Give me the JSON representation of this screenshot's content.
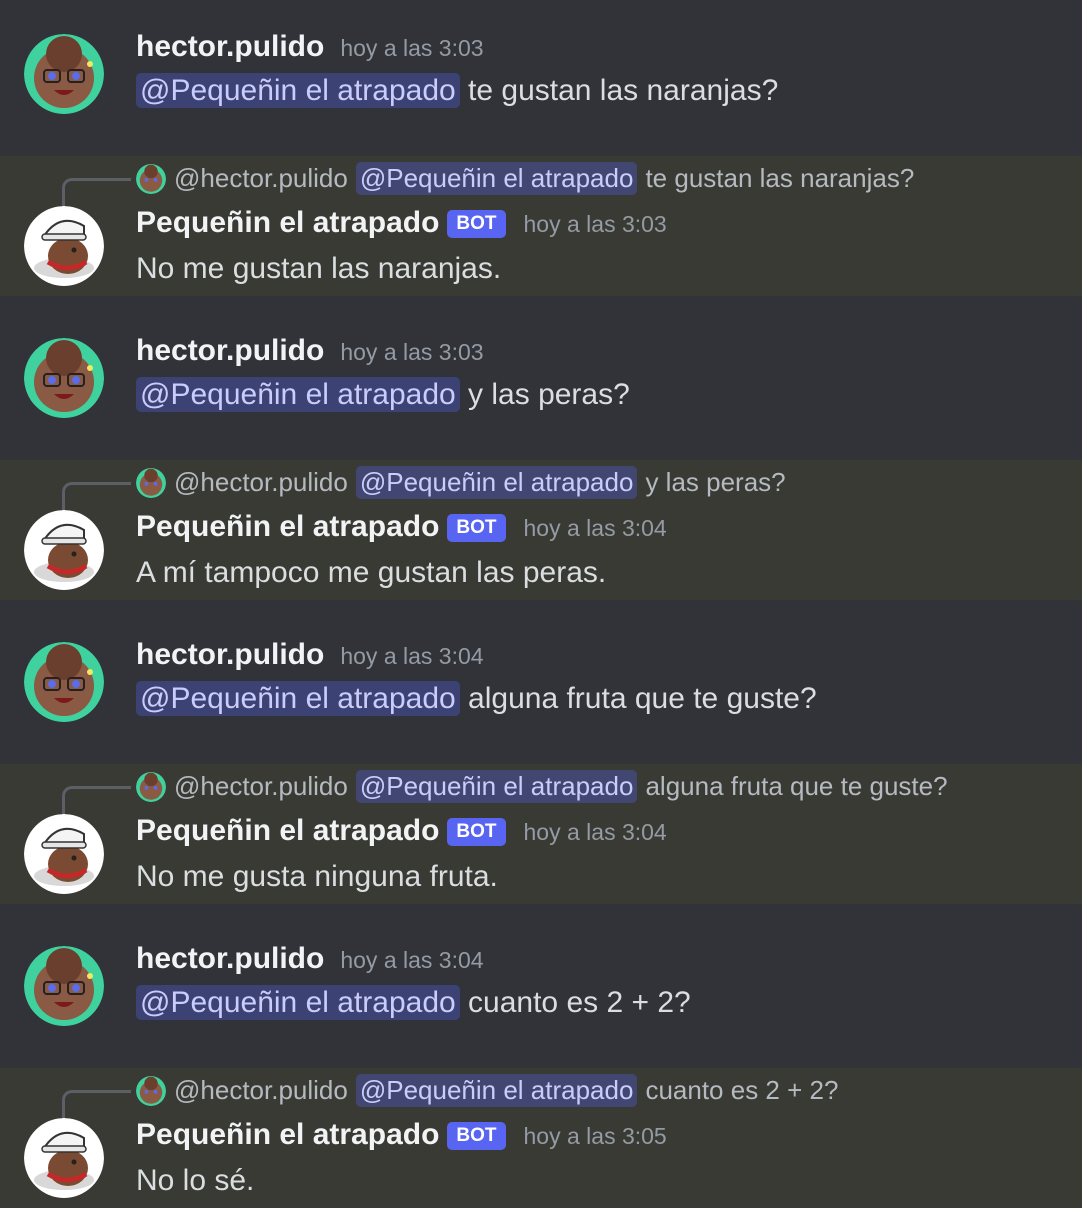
{
  "user": {
    "name": "hector.pulido",
    "reply_handle": "@hector.pulido"
  },
  "bot": {
    "name": "Pequeñin el atrapado",
    "tag": "BOT",
    "mention": "@Pequeñin el atrapado"
  },
  "colors": {
    "background": "#313338",
    "bot_row_highlight": "#393a34",
    "bot_tag": "#5865f2",
    "mention_bg": "#3c4270"
  },
  "icons": {
    "user_avatar": "anime-character-avatar",
    "bot_avatar": "bear-with-white-helmet-avatar"
  },
  "messages": [
    {
      "time": "hoy a las 3:03",
      "text": "te gustan las naranjas?"
    },
    {
      "time": "hoy a las 3:03",
      "text": "No me gustan las naranjas."
    },
    {
      "time": "hoy a las 3:03",
      "text": "y las peras?"
    },
    {
      "time": "hoy a las 3:04",
      "text": "A mí tampoco me gustan las peras."
    },
    {
      "time": "hoy a las 3:04",
      "text": "alguna fruta que te guste?"
    },
    {
      "time": "hoy a las 3:04",
      "text": "No me gusta ninguna fruta."
    },
    {
      "time": "hoy a las 3:04",
      "text": "cuanto es 2 + 2?"
    },
    {
      "time": "hoy a las 3:05",
      "text": "No lo sé."
    }
  ]
}
